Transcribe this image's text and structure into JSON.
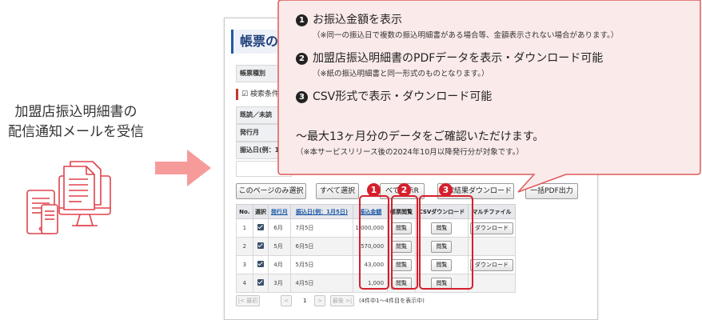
{
  "left_caption": {
    "line1": "加盟店振込明細書の",
    "line2": "配信通知メールを受信"
  },
  "illustration": {
    "icon": "devices-document-icon"
  },
  "arrow": {
    "icon": "arrow-right-icon",
    "color": "#f79a9a"
  },
  "window": {
    "title": "帳票の一",
    "form_labels": [
      "帳票種別",
      "既読／未読",
      "発行月",
      "振込日(例：1/"
    ],
    "search_condition": "検索条件"
  },
  "buttons": {
    "select_page": "このページのみ選択",
    "select_all": "すべて選択",
    "display_r": "べて表示R",
    "search_result_dl": "検索結果ダウンロード",
    "bulk_pdf": "一括PDF出力"
  },
  "table": {
    "headers": [
      "No.",
      "選択",
      "発行月",
      "振込日(例：1月5日)",
      "振込金額",
      "帳票閲覧",
      "CSVダウンロード",
      "マルチファイル"
    ],
    "rows": [
      {
        "no": "1",
        "month": "6月",
        "date": "7月5日",
        "amount": "1,000,000",
        "view": "閲覧",
        "csv": "閲覧",
        "multi": "ダウンロード"
      },
      {
        "no": "2",
        "month": "5月",
        "date": "6月5日",
        "amount": "570,000",
        "view": "閲覧",
        "csv": "閲覧",
        "multi": ""
      },
      {
        "no": "3",
        "month": "4月",
        "date": "5月5日",
        "amount": "43,000",
        "view": "閲覧",
        "csv": "閲覧",
        "multi": "ダウンロード"
      },
      {
        "no": "4",
        "month": "3月",
        "date": "4月5日",
        "amount": "1,000",
        "view": "閲覧",
        "csv": "閲覧",
        "multi": ""
      }
    ]
  },
  "pager": {
    "first": "最初",
    "prev": "<",
    "page": "1",
    "next": ">",
    "last": "最後",
    "info": "(4件中1〜4件目を表示中)"
  },
  "badges": [
    "1",
    "2",
    "3"
  ],
  "callout": {
    "item1_num": "1",
    "item1_title": "お振込金額を表示",
    "item1_note": "（※同一の振込日で複数の振込明細書がある場合等、金額表示されない場合があります。）",
    "item2_num": "2",
    "item2_title": "加盟店振込明細書のPDFデータを表示・ダウンロード可能",
    "item2_note": "（※紙の振込明細書と同一形式のものとなります。）",
    "item3_num": "3",
    "item3_title": "CSV形式で表示・ダウンロード可能",
    "summary": "〜最大13ヶ月分のデータをご確認いただけます。",
    "summary_note": "（※本サービスリリース後の2024年10月以降発行分が対象です。）",
    "bg_color": "#fbeaea",
    "border_color": "#e05a5a"
  },
  "highlight_color": "#d61f2c"
}
